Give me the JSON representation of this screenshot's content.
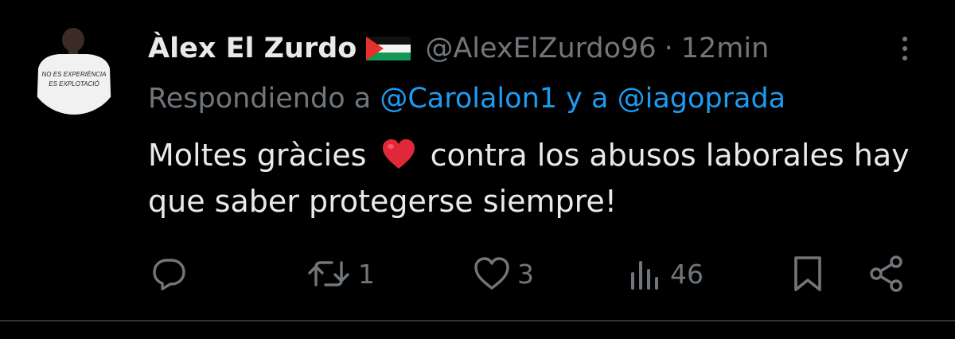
{
  "tweet": {
    "display_name": "Àlex El Zurdo",
    "handle": "@AlexElZurdo96",
    "separator": "·",
    "timestamp": "12min",
    "reply_prefix": "Respondiendo a",
    "reply_mention_1": "@Carolalon1",
    "reply_join": "y a",
    "reply_mention_2": "@iagoprada",
    "text_before_emoji": "Moltes gràcies",
    "text_after_emoji": "contra los abusos laborales hay que saber protegerse siempre!",
    "avatar_shirt_text_line1": "NO ES EXPERIÈNCIA",
    "avatar_shirt_text_line2": "ES EXPLOTACIÓ"
  },
  "actions": {
    "reply_count": "",
    "retweet_count": "1",
    "like_count": "3",
    "views_count": "46"
  },
  "icons": {
    "flag": "palestine-flag-icon",
    "emoji": "red-heart-emoji",
    "reply": "reply-icon",
    "retweet": "retweet-icon",
    "like": "heart-icon",
    "views": "views-icon",
    "bookmark": "bookmark-icon",
    "share": "share-icon",
    "more": "more-icon"
  },
  "colors": {
    "background": "#000000",
    "primary_text": "#e7e9ea",
    "secondary_text": "#71767b",
    "link": "#1d9bf0",
    "heart_emoji": "#e0283a"
  }
}
